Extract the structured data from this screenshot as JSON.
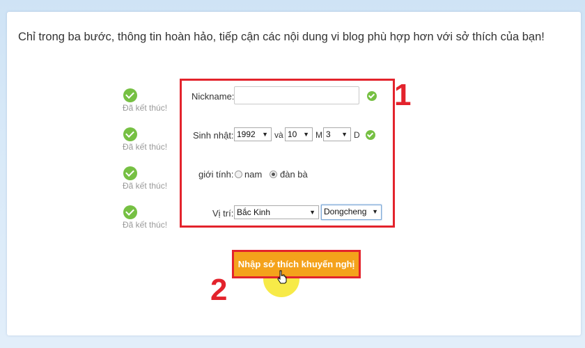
{
  "intro": "Chỉ trong ba bước, thông tin hoàn hảo, tiếp cận các nội dung vi blog phù hợp hơn với sở thích của bạn!",
  "steps": [
    {
      "label": "Đã kết thúc!"
    },
    {
      "label": "Đã kết thúc!"
    },
    {
      "label": "Đã kết thúc!"
    },
    {
      "label": "Đã kết thúc!"
    }
  ],
  "form": {
    "nickname_label": "Nickname:",
    "nickname_value": "",
    "birthday_label": "Sinh nhật:",
    "year": "1992",
    "and_label": "và",
    "month": "10",
    "month_unit": "M",
    "day": "3",
    "day_unit": "D",
    "gender_label": "giới tính:",
    "gender_options": [
      "nam",
      "đàn bà"
    ],
    "gender_selected": "đàn bà",
    "location_label": "Vị trí:",
    "province": "Bắc Kinh",
    "district": "Dongcheng"
  },
  "submit_label": "Nhập sở thích khuyến nghị",
  "annotations": [
    "1",
    "2"
  ],
  "colors": {
    "accent_red": "#e3232c",
    "button_orange": "#f4a21b",
    "check_green": "#76c043"
  }
}
